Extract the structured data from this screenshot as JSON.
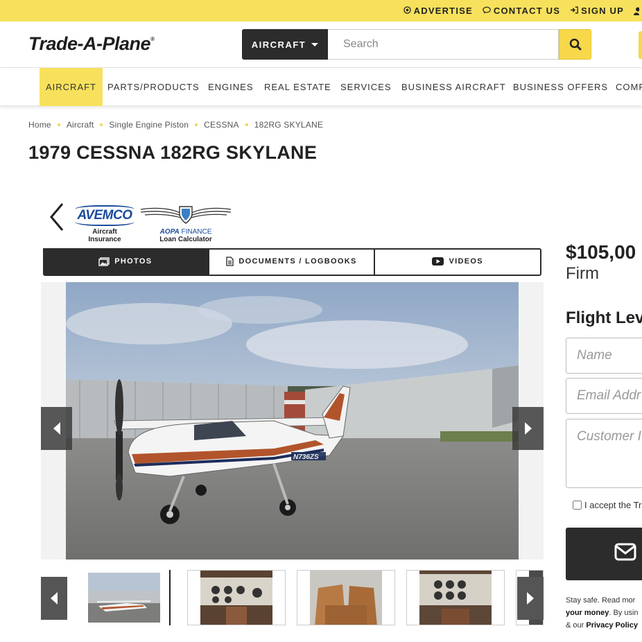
{
  "topbar": {
    "links": [
      {
        "icon": "target-icon",
        "label": "ADVERTISE"
      },
      {
        "icon": "chat-icon",
        "label": "CONTACT US"
      },
      {
        "icon": "signin-icon",
        "label": "SIGN UP"
      }
    ]
  },
  "header": {
    "logo": "Trade-A-Plane",
    "category_label": "AIRCRAFT",
    "search_placeholder": "Search"
  },
  "nav": {
    "items": [
      "AIRCRAFT",
      "PARTS/PRODUCTS",
      "ENGINES",
      "REAL ESTATE",
      "SERVICES",
      "BUSINESS AIRCRAFT",
      "BUSINESS OFFERS",
      "COMP"
    ]
  },
  "breadcrumb": [
    "Home",
    "Aircraft",
    "Single Engine Piston",
    "CESSNA",
    "182RG SKYLANE"
  ],
  "listing": {
    "title": "1979 CESSNA 182RG SKYLANE",
    "price": "$105,00",
    "price_note": "Firm"
  },
  "sponsors": {
    "avemco_name": "AVEMCO",
    "avemco_line1": "Aircraft",
    "avemco_line2": "Insurance",
    "aopa_name": "AOPA",
    "aopa_finance": "FINANCE",
    "aopa_line": "Loan Calculator"
  },
  "tabs": [
    {
      "icon": "photos-icon",
      "label": "PHOTOS"
    },
    {
      "icon": "document-icon",
      "label": "DOCUMENTS / LOGBOOKS"
    },
    {
      "icon": "video-icon",
      "label": "VIDEOS"
    }
  ],
  "gallery": {
    "tail_number": "N736ZS"
  },
  "form": {
    "title": "Flight Lev",
    "name_placeholder": "Name",
    "email_placeholder": "Email Addr",
    "message_placeholder": "Customer I",
    "accept_text": "I accept the Tr",
    "fine_line1": "Stay safe. Read mor",
    "fine_line2_bold": "your money",
    "fine_line2_rest": ". By usin",
    "fine_line3_pre": "& our ",
    "fine_line3_bold": "Privacy Policy"
  },
  "colors": {
    "accent_yellow": "#f7e15c",
    "dark": "#2c2c2c",
    "brand_blue": "#1a4b9b"
  }
}
